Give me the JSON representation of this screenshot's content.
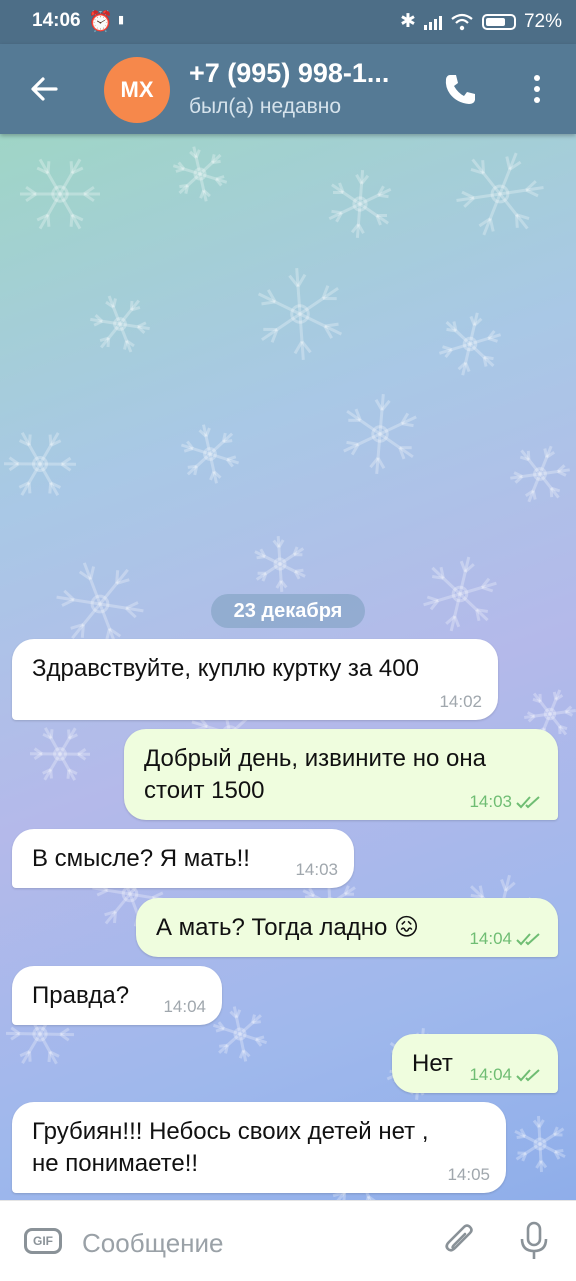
{
  "status_bar": {
    "time": "14:06",
    "data_label": "0.05",
    "battery": "72%",
    "battery_level": 0.72
  },
  "header": {
    "avatar_initials": "МХ",
    "avatar_color": "#f6884b",
    "name": "+7 (995) 998-1...",
    "status": "был(а) недавно",
    "icons": [
      "back-arrow-icon",
      "phone-icon",
      "more-vertical-icon"
    ]
  },
  "chat": {
    "date": "23 декабря",
    "messages": [
      {
        "dir": "in",
        "lines": [
          "Здравствуйте, куплю куртку за 400"
        ],
        "time": "14:02"
      },
      {
        "dir": "out",
        "lines": [
          "Добрый день, извините но она",
          "стоит 1500"
        ],
        "time": "14:03",
        "read": true
      },
      {
        "dir": "in",
        "lines": [
          "В смысле? Я мать!!"
        ],
        "time": "14:03"
      },
      {
        "dir": "out",
        "lines": [
          "А мать? Тогда ладно 😖"
        ],
        "time": "14:04",
        "read": true
      },
      {
        "dir": "in",
        "lines": [
          "Правда?"
        ],
        "time": "14:04"
      },
      {
        "dir": "out",
        "lines": [
          "Нет"
        ],
        "time": "14:04",
        "read": true
      },
      {
        "dir": "in",
        "lines": [
          "Грубиян!!! Небось своих детей нет ,",
          "не понимаете!!"
        ],
        "time": "14:05"
      }
    ]
  },
  "input": {
    "gif_label": "GIF",
    "placeholder": "Сообщение",
    "icons": [
      "attach-icon",
      "microphone-icon"
    ]
  },
  "colors": {
    "header": "#557a95",
    "outgoing_bubble": "#effdde",
    "incoming_bubble": "#ffffff",
    "read_check": "#6fbd73"
  }
}
